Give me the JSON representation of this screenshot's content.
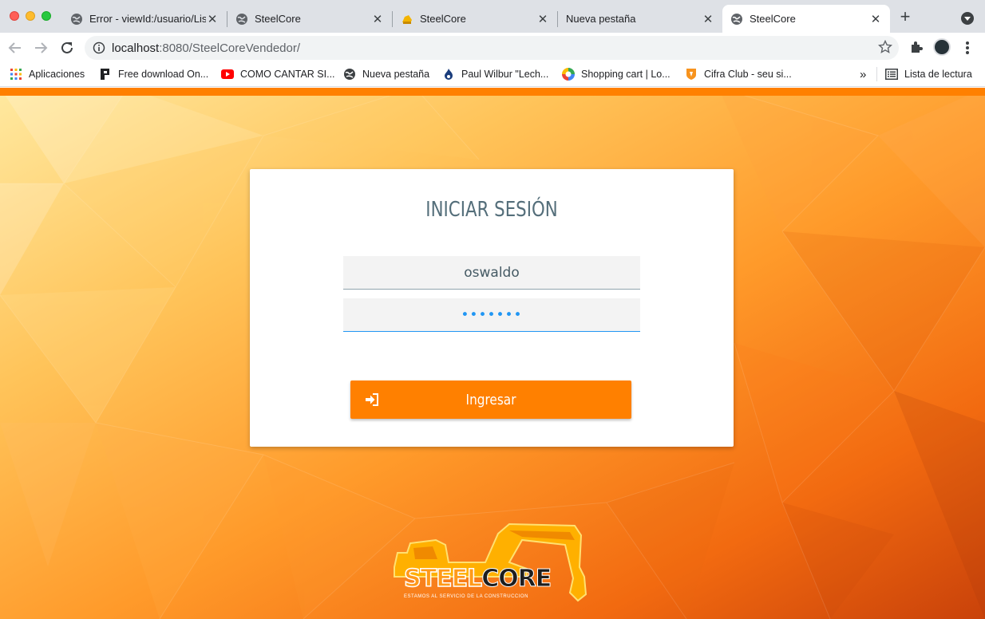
{
  "browser": {
    "tabs": [
      {
        "title": "Error - viewId:/usuario/Lis",
        "favicon": "globe-icon",
        "active": false
      },
      {
        "title": "SteelCore",
        "favicon": "globe-icon",
        "active": false
      },
      {
        "title": "SteelCore",
        "favicon": "steelcore-favicon",
        "active": false
      },
      {
        "title": "Nueva pestaña",
        "favicon": "none",
        "active": false
      },
      {
        "title": "SteelCore",
        "favicon": "globe-icon",
        "active": true
      }
    ],
    "url_host": "localhost",
    "url_rest": ":8080/SteelCoreVendedor/"
  },
  "bookmarks": {
    "items": [
      {
        "label": "Aplicaciones",
        "icon": "apps-grid-icon"
      },
      {
        "label": "Free download On...",
        "icon": "download-site-icon"
      },
      {
        "label": "COMO CANTAR SI...",
        "icon": "youtube-icon"
      },
      {
        "label": "Nueva pestaña",
        "icon": "globe-icon"
      },
      {
        "label": "Paul Wilbur \"Lech...",
        "icon": "flame-icon"
      },
      {
        "label": "Shopping cart | Lo...",
        "icon": "colorwheel-icon"
      },
      {
        "label": "Cifra Club - seu si...",
        "icon": "cifraclub-icon"
      }
    ],
    "overflow": "»",
    "reading_list": "Lista de lectura"
  },
  "login": {
    "title": "INICIAR SESIÓN",
    "username_value": "oswaldo",
    "password_value": "•••••••",
    "submit_label": "Ingresar"
  },
  "logo": {
    "steel": "STEEL",
    "core": "CORE",
    "tagline": "ESTAMOS AL SERVICIO DE LA CONSTRUCCION"
  },
  "colors": {
    "accent": "#ff8000",
    "title": "#546e7a",
    "focus": "#2196f3"
  }
}
